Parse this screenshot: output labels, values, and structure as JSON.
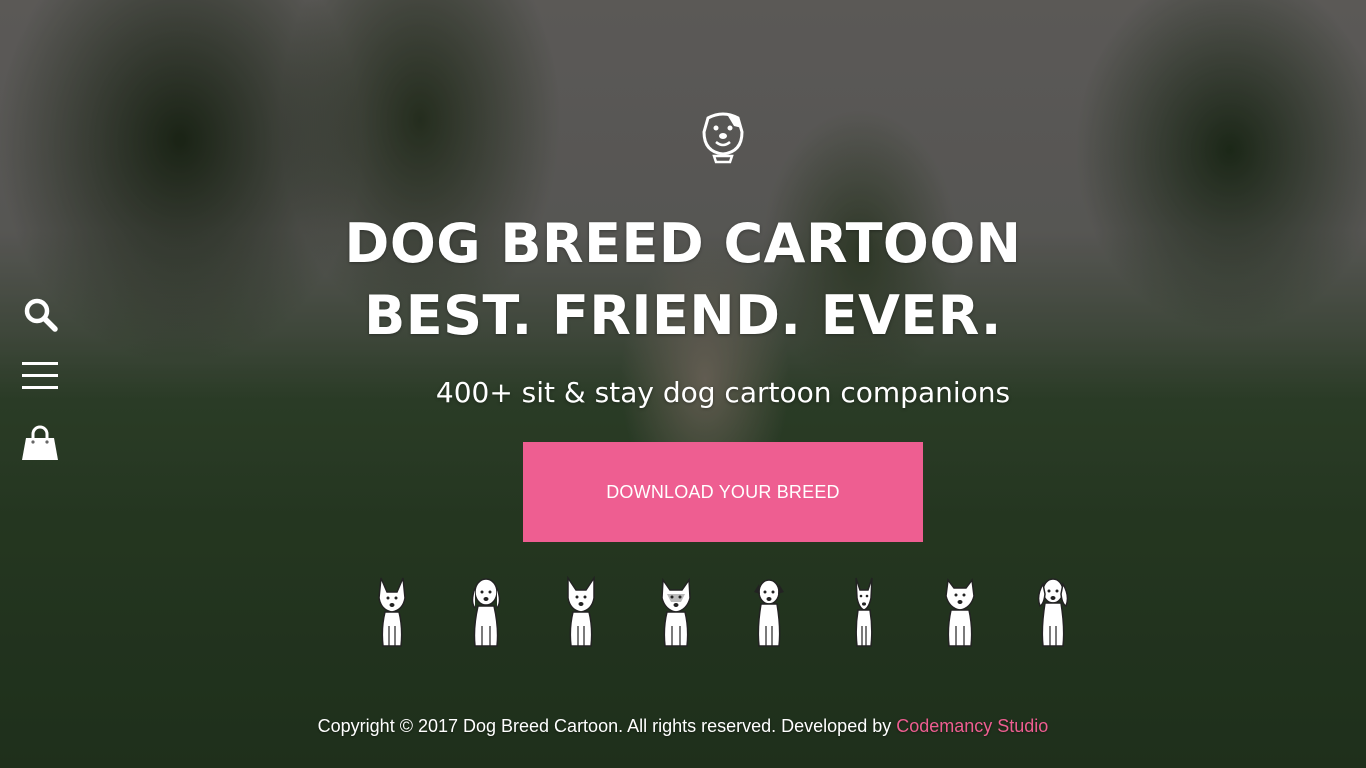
{
  "hero": {
    "title_line1": "DOG BREED CARTOON",
    "title_line2": "BEST. FRIEND. EVER.",
    "subtitle": "400+ sit & stay dog cartoon companions",
    "cta_label": "DOWNLOAD YOUR BREED"
  },
  "side_nav": {
    "icons": [
      "search-icon",
      "menu-icon",
      "shopping-bag-icon"
    ]
  },
  "footer": {
    "copyright": "Copyright © 2017 Dog Breed Cartoon. All rights reserved. Developed by ",
    "studio_link": "Codemancy Studio"
  },
  "colors": {
    "accent": "#ee5e91",
    "text": "#ffffff"
  },
  "dog_icons": [
    "dog-icon-1",
    "dog-icon-2",
    "dog-icon-3",
    "dog-icon-4",
    "dog-icon-5",
    "dog-icon-6",
    "dog-icon-7",
    "dog-icon-8"
  ]
}
